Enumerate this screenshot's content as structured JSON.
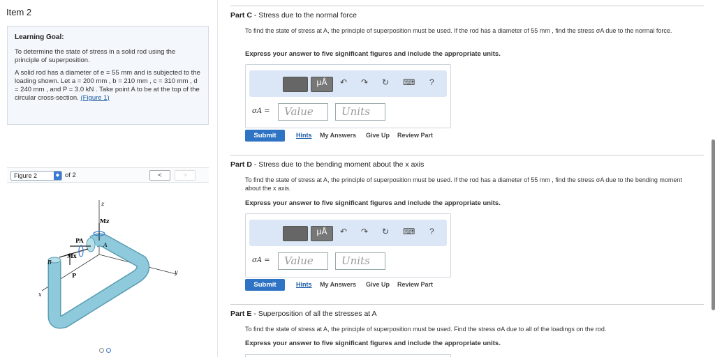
{
  "item": {
    "title": "Item 2"
  },
  "goal": {
    "title": "Learning Goal:",
    "intro": "To determine the state of stress in a solid rod using the principle of superposition.",
    "problem": "A solid rod has a diameter of e = 55 mm and is subjected to the loading shown. Let a = 200 mm , b = 210 mm , c = 310 mm , d = 240 mm , and P = 3.0 kN . Take point A to be at the top of the circular cross-section. ",
    "figure_link": "(Figure 1)"
  },
  "figure": {
    "select_label": "Figure 2",
    "of_label": "of 2",
    "prev": "<",
    "next": ">",
    "labels": {
      "z": "z",
      "mz": "Mz",
      "pa": "PA",
      "a": "A",
      "mx": "Mx",
      "b": "B",
      "p": "P",
      "x": "x",
      "y": "y"
    }
  },
  "toolbar": {
    "units_glyph": "μÅ",
    "undo": "↶",
    "redo": "↷",
    "reset": "↻",
    "keyboard": "⌨",
    "help": "?"
  },
  "parts": [
    {
      "label": "Part C",
      "title": " - Stress due to the normal force",
      "desc": "To find the state of stress at A, the principle of superposition must be used. If the rod has a diameter of 55 mm , find the stress σA due to the normal force.",
      "instr": "Express your answer to five significant figures and include the appropriate units.",
      "sigma": "σA =",
      "value_placeholder": "Value",
      "units_placeholder": "Units"
    },
    {
      "label": "Part D",
      "title": " - Stress due to the bending moment about the x axis",
      "desc": "To find the state of stress at A, the principle of superposition must be used. If the rod has a diameter of 55 mm , find the stress σA due to the bending moment about the x axis.",
      "instr": "Express your answer to five significant figures and include the appropriate units.",
      "sigma": "σA =",
      "value_placeholder": "Value",
      "units_placeholder": "Units"
    },
    {
      "label": "Part E",
      "title": " - Superposition of all the stresses at A",
      "desc": "To find the state of stress at A, the principle of superposition must be used. Find the stress σA due to all of the loadings on the rod.",
      "instr": "Express your answer to five significant figures and include the appropriate units."
    }
  ],
  "actions": {
    "submit": "Submit",
    "hints": "Hints",
    "my_answers": "My Answers",
    "give_up": "Give Up",
    "review": "Review Part"
  },
  "colors": {
    "accent": "#2f74c4",
    "toolbar_bg": "#dbe7f7",
    "rod": "#8ec9dc"
  }
}
